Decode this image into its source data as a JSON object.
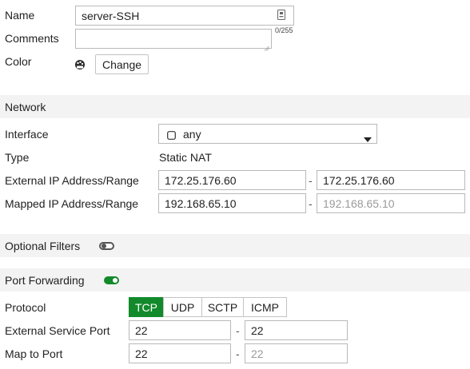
{
  "top": {
    "name_label": "Name",
    "name_value": "server-SSH",
    "comments_label": "Comments",
    "comments_counter": "0/255",
    "color_label": "Color",
    "color_change_button": "Change"
  },
  "network": {
    "section_title": "Network",
    "interface_label": "Interface",
    "interface_value": "any",
    "type_label": "Type",
    "type_value": "Static NAT",
    "external_ip_label": "External IP Address/Range",
    "external_ip_start": "172.25.176.60",
    "external_ip_end": "172.25.176.60",
    "mapped_ip_label": "Mapped IP Address/Range",
    "mapped_ip_start": "192.168.65.10",
    "mapped_ip_end_placeholder": "192.168.65.10",
    "range_separator": "-"
  },
  "optional_filters": {
    "title": "Optional Filters",
    "enabled": false
  },
  "port_forwarding": {
    "title": "Port Forwarding",
    "enabled": true,
    "protocol_label": "Protocol",
    "protocols": [
      "TCP",
      "UDP",
      "SCTP",
      "ICMP"
    ],
    "selected_protocol": "TCP",
    "external_port_label": "External Service Port",
    "external_port_start": "22",
    "external_port_end": "22",
    "map_port_label": "Map to Port",
    "map_port_start": "22",
    "map_port_end_placeholder": "22"
  },
  "colors": {
    "accent_green": "#128a2b",
    "section_bg": "#f3f3f3",
    "input_border": "#b9b9b9",
    "placeholder_text": "#9a9a9a"
  },
  "icons": {
    "name_field_icon": "id-card-icon",
    "color_swatch_icon": "palette-icon",
    "interface_icon": "interface-square-icon",
    "dropdown_icon": "caret-down-icon"
  }
}
